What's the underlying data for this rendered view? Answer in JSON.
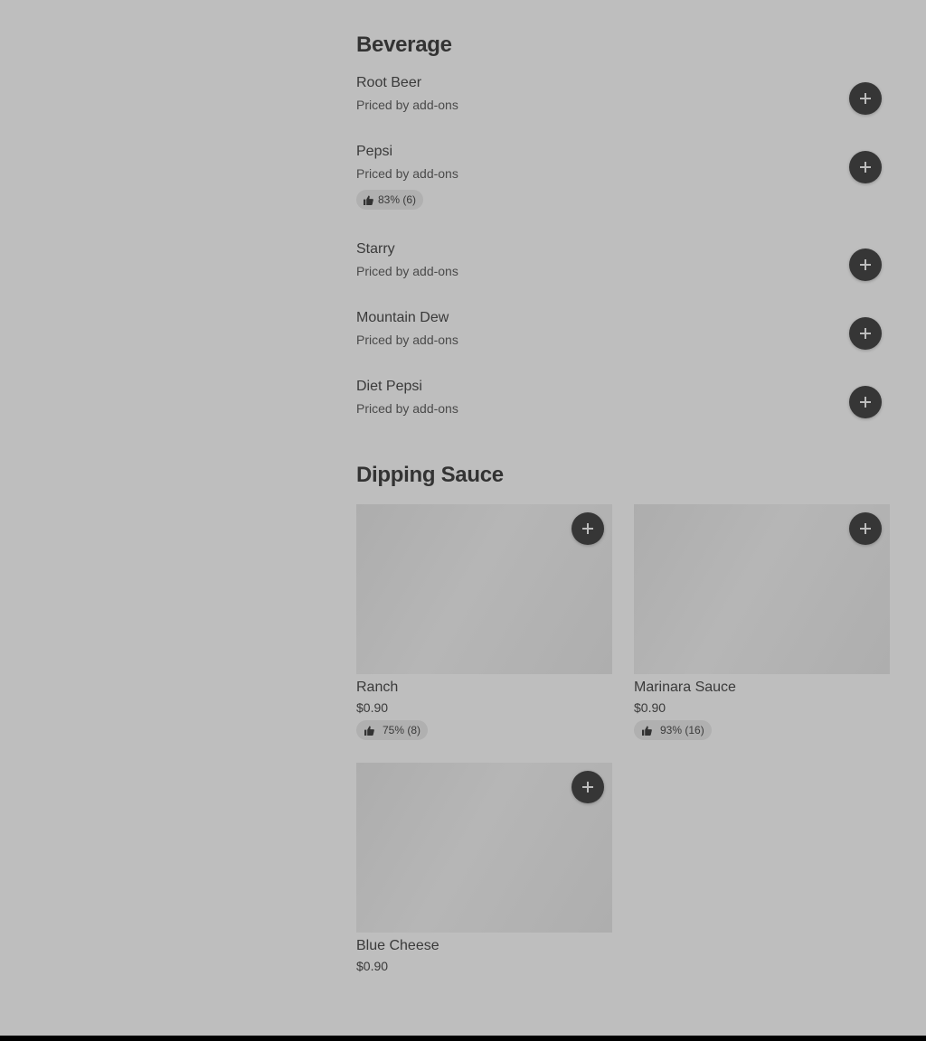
{
  "beverage": {
    "title": "Beverage",
    "items": [
      {
        "name": "Root Beer",
        "subtitle": "Priced by add-ons",
        "rating": ""
      },
      {
        "name": "Pepsi",
        "subtitle": "Priced by add-ons",
        "rating": "83% (6)"
      },
      {
        "name": "Starry",
        "subtitle": "Priced by add-ons",
        "rating": ""
      },
      {
        "name": "Mountain Dew",
        "subtitle": "Priced by add-ons",
        "rating": ""
      },
      {
        "name": "Diet Pepsi",
        "subtitle": "Priced by add-ons",
        "rating": ""
      }
    ]
  },
  "dipping_sauce": {
    "title": "Dipping Sauce",
    "items": [
      {
        "name": "Ranch",
        "price": "$0.90",
        "rating": "75% (8)"
      },
      {
        "name": "Marinara Sauce",
        "price": "$0.90",
        "rating": "93% (16)"
      },
      {
        "name": "Blue Cheese",
        "price": "$0.90",
        "rating": ""
      }
    ]
  },
  "icons": {
    "add": "plus-icon",
    "rating": "thumbs-up-icon"
  },
  "colors": {
    "background": "#bebebe",
    "button": "#363636",
    "text": "#333333"
  }
}
